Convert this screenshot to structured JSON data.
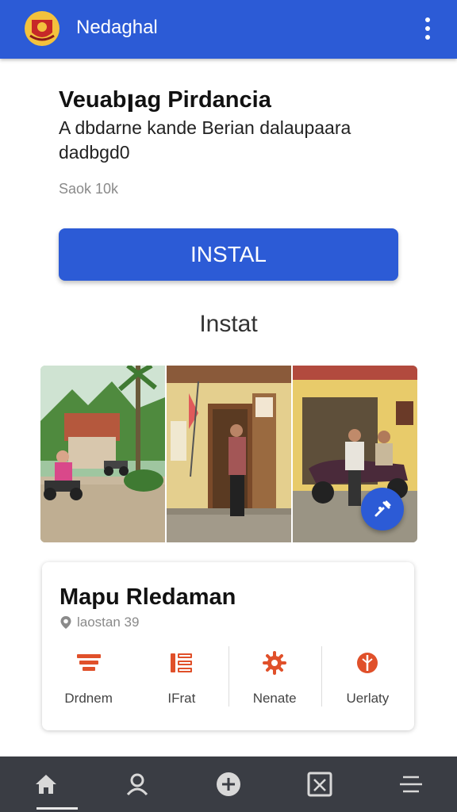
{
  "appbar": {
    "title": "Nedaghal",
    "logo_icon": "emblem-logo",
    "menu_icon": "more-vert-icon",
    "color": "#2c5bd6"
  },
  "app": {
    "title": "Veuabꞁag Pirdancia",
    "description": "A dbdarne kande Berian dalaupaara dadbgd0",
    "size": "Saok 10k",
    "install_label": "INSTAL"
  },
  "gallery": {
    "heading": "Instat",
    "images": [
      "village-street-photo",
      "shop-doorway-photo",
      "yellow-house-motorbike-photo"
    ],
    "fab_icon": "tools-icon"
  },
  "info_card": {
    "title": "Mapu Rledaman",
    "location_icon": "location-pin-icon",
    "location": "laostan 39",
    "features": [
      {
        "icon": "stack-icon",
        "label": "Drdnem"
      },
      {
        "icon": "list-icon",
        "label": "IFrat"
      },
      {
        "icon": "gear-icon",
        "label": "Nenate"
      },
      {
        "icon": "tag-icon",
        "label": "Uerlaty"
      }
    ],
    "accent": "#e0502a"
  },
  "bottom_nav": {
    "items": [
      "home-icon",
      "profile-icon",
      "add-icon",
      "image-icon",
      "menu-icon"
    ],
    "background": "#3a3d44"
  }
}
